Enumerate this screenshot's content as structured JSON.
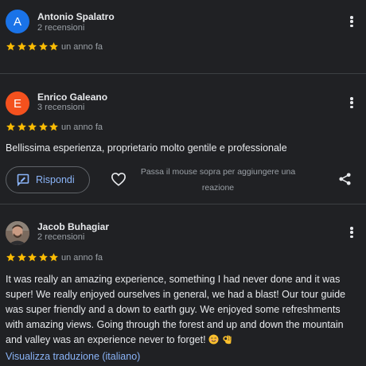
{
  "colors": {
    "background": "#202124",
    "star": "#fbbc04",
    "link": "#8ab4f8",
    "avatar_antonio": "#1a73e8",
    "avatar_enrico": "#f4511e"
  },
  "reviews": [
    {
      "avatar_letter": "A",
      "author": "Antonio Spalatro",
      "review_count": "2 recensioni",
      "rating": 5,
      "date": "un anno fa",
      "text": ""
    },
    {
      "avatar_letter": "E",
      "author": "Enrico Galeano",
      "review_count": "3 recensioni",
      "rating": 5,
      "date": "un anno fa",
      "text": "Bellissima esperienza, proprietario molto gentile e professionale",
      "reply_label": "Rispondi",
      "reaction_hint": "Passa il mouse sopra per aggiungere una reazione"
    },
    {
      "avatar_letter": "",
      "author": "Jacob Buhagiar",
      "review_count": "2 recensioni",
      "rating": 5,
      "date": "un anno fa",
      "text": "It was really an amazing experience, something I had never done and it was super! We really enjoyed ourselves in general, we had a blast! Our tour guide was super friendly and a down to earth guy. We enjoyed some refreshments with amazing views. Going through the forest and up and down the mountain and valley was an experience never to forget!",
      "translate_link": "Visualizza traduzione (italiano)"
    }
  ],
  "icons": {
    "reply": "reply-icon",
    "heart": "heart-icon",
    "share": "share-icon",
    "more": "more-vert-icon",
    "star": "star-icon",
    "emojis": [
      "smiling-face-emoji",
      "ok-hand-emoji"
    ]
  }
}
